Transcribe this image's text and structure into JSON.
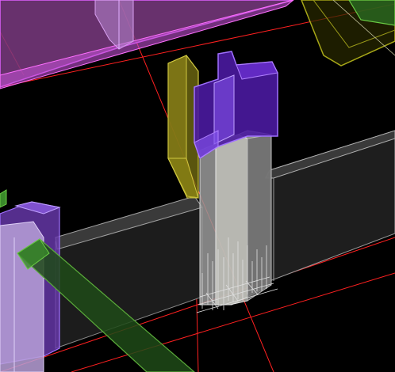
{
  "viewport": {
    "kind": "3d-model-viewport",
    "background_color": "#000000"
  },
  "colors": {
    "axis_red": "#ff2020",
    "magenta_slab": "#b04ab8",
    "violet_column": "#6a2bd6",
    "olive_panel": "#a8a018",
    "green_beam": "#3a8a2a",
    "grey_wall": "#2e2e2e",
    "white_column": "#d0d0d0"
  },
  "objects": [
    {
      "id": "magenta-slab",
      "label": ""
    },
    {
      "id": "violet-column-cap",
      "label": ""
    },
    {
      "id": "olive-panel",
      "label": ""
    },
    {
      "id": "grey-wall-left",
      "label": ""
    },
    {
      "id": "grey-wall-right",
      "label": ""
    },
    {
      "id": "green-beam",
      "label": ""
    },
    {
      "id": "violet-column-left",
      "label": ""
    },
    {
      "id": "rebar-cluster",
      "label": ""
    }
  ]
}
